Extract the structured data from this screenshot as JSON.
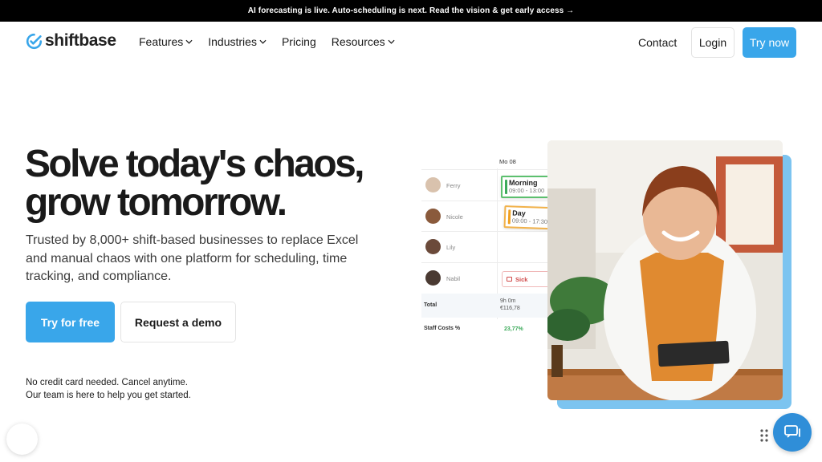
{
  "announcement": {
    "text": "AI forecasting is live. Auto-scheduling is next. Read the vision & get early access →"
  },
  "brand": {
    "name": "shiftbase",
    "accent": "#39a6ea"
  },
  "nav": {
    "items": [
      {
        "label": "Features",
        "dropdown": true
      },
      {
        "label": "Industries",
        "dropdown": true
      },
      {
        "label": "Pricing",
        "dropdown": false
      },
      {
        "label": "Resources",
        "dropdown": true
      }
    ],
    "contact": "Contact",
    "login": "Login",
    "try_now": "Try now"
  },
  "hero": {
    "title_line1": "Solve today's chaos,",
    "title_line2": "grow tomorrow.",
    "subtitle": "Trusted by 8,000+ shift-based businesses to replace Excel and manual chaos with one platform for scheduling, time tracking, and compliance.",
    "cta_primary": "Try for free",
    "cta_secondary": "Request a demo",
    "note_line1": "No credit card needed. Cancel anytime.",
    "note_line2": "Our team is here to help you get started."
  },
  "schedule": {
    "day": "Mo 08",
    "employees": [
      {
        "name": "Ferry"
      },
      {
        "name": "Nicole"
      },
      {
        "name": "Lily"
      },
      {
        "name": "Nabil"
      }
    ],
    "shifts": [
      {
        "name": "Morning",
        "time": "09:00 - 13:00",
        "color": "#3caa5a"
      },
      {
        "name": "Day",
        "time": "09:00 - 17:30",
        "color": "#f0a020"
      }
    ],
    "sick_label": "Sick",
    "total_label": "Total",
    "total_hours": "9h 0m",
    "total_cost": "€116,78",
    "staff_cost_label": "Staff Costs %",
    "staff_cost_value": "23,77%"
  },
  "icons": {
    "chat": "chat-bubble-icon",
    "drag": "drag-handle-icon",
    "logo": "check-circle-icon"
  }
}
